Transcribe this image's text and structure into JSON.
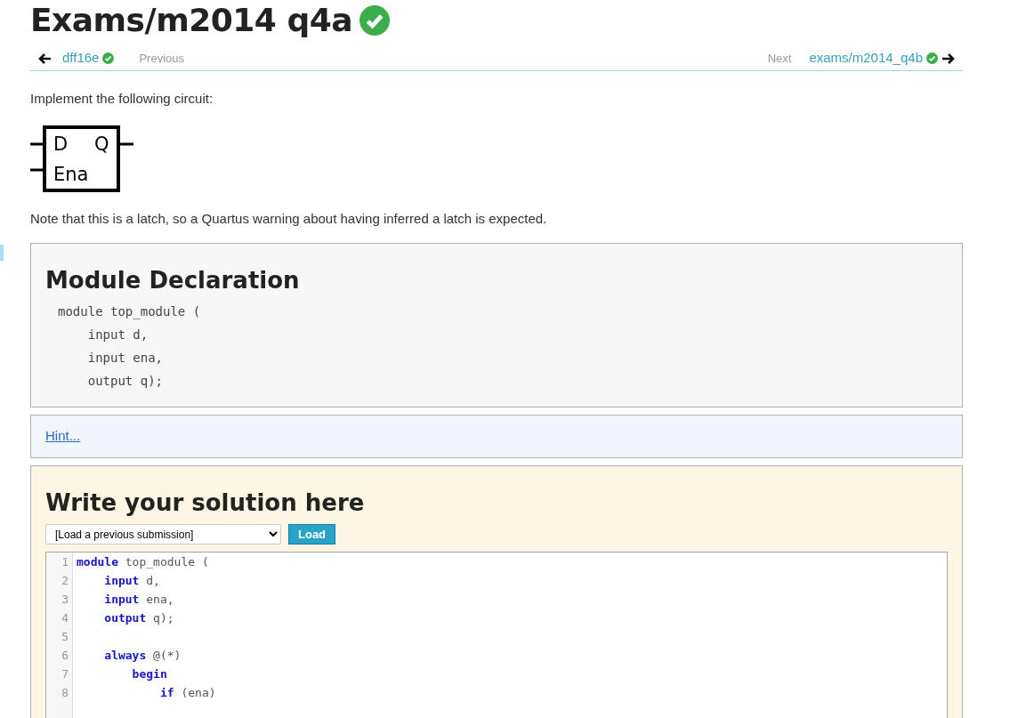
{
  "title": "Exams/m2014 q4a",
  "solved": true,
  "nav": {
    "previous_link": "dff16e",
    "previous_solved": true,
    "previous_label": "Previous",
    "next_label": "Next",
    "next_link": "exams/m2014_q4b",
    "next_solved": true
  },
  "intro": "Implement the following circuit:",
  "circuit": {
    "inputs": [
      "D",
      "Ena"
    ],
    "output": "Q"
  },
  "note": "Note that this is a latch, so a Quartus warning about having inferred a latch is expected.",
  "module_declaration": {
    "heading": "Module Declaration",
    "code": [
      "module top_module (",
      "    input d,",
      "    input ena,",
      "    output q);"
    ]
  },
  "hint": {
    "link": "Hint..."
  },
  "solution": {
    "heading": "Write your solution here",
    "submission_select": "[Load a previous submission]",
    "load_button": "Load",
    "editor_lines": [
      {
        "number": "1",
        "tokens": [
          {
            "text": "module",
            "kind": "keyword"
          },
          {
            "text": " top_module (",
            "kind": "plain"
          }
        ]
      },
      {
        "number": "2",
        "tokens": [
          {
            "text": "    input",
            "kind": "keyword"
          },
          {
            "text": " d,",
            "kind": "plain"
          }
        ]
      },
      {
        "number": "3",
        "tokens": [
          {
            "text": "    input",
            "kind": "keyword"
          },
          {
            "text": " ena,",
            "kind": "plain"
          }
        ]
      },
      {
        "number": "4",
        "tokens": [
          {
            "text": "    output",
            "kind": "keyword"
          },
          {
            "text": " q);",
            "kind": "plain"
          }
        ]
      },
      {
        "number": "5"
      },
      {
        "number": "6",
        "tokens": [
          {
            "text": "    always",
            "kind": "keyword"
          },
          {
            "text": " @(*)",
            "kind": "plain"
          }
        ]
      },
      {
        "number": "7",
        "tokens": [
          {
            "text": "        begin",
            "kind": "keyword"
          }
        ]
      },
      {
        "number": "8",
        "tokens": [
          {
            "text": "            if",
            "kind": "keyword"
          },
          {
            "text": " (ena)",
            "kind": "plain"
          }
        ]
      }
    ]
  }
}
